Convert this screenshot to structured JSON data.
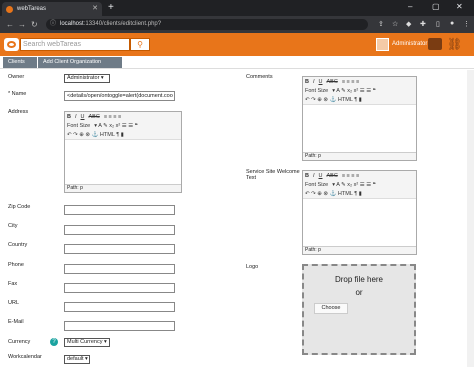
{
  "browser": {
    "tab_title": "webTareas",
    "url_host": "localhost",
    "url_path": ":13340/clients/editclient.php?",
    "colors": {
      "accent": "#e8751a"
    }
  },
  "header": {
    "search_placeholder": "Search webTareas",
    "user_name": "Administrator"
  },
  "breadcrumb": {
    "items": [
      "Clients",
      "Add Client Organization"
    ]
  },
  "form": {
    "owner_label": "Owner",
    "owner_value": "Administrator",
    "name_label": "* Name",
    "name_value": "<details/open/ontoggle=alert(document.coo",
    "address_label": "Address",
    "zip_label": "Zip Code",
    "city_label": "City",
    "country_label": "Country",
    "phone_label": "Phone",
    "fax_label": "Fax",
    "url_label": "URL",
    "email_label": "E-Mail",
    "currency_label": "Currency",
    "currency_value": "Multi Currency",
    "workcal_label": "Workcalendar",
    "workcal_value": "default",
    "comments_label": "Comments",
    "welcome_label": "Service Site Welcome Text",
    "logo_label": "Logo",
    "editor_fontsize": "Font Size",
    "editor_path": "Path: p",
    "dropzone_text": "Drop file here",
    "dropzone_or": "or",
    "choose_label": "Choose"
  }
}
